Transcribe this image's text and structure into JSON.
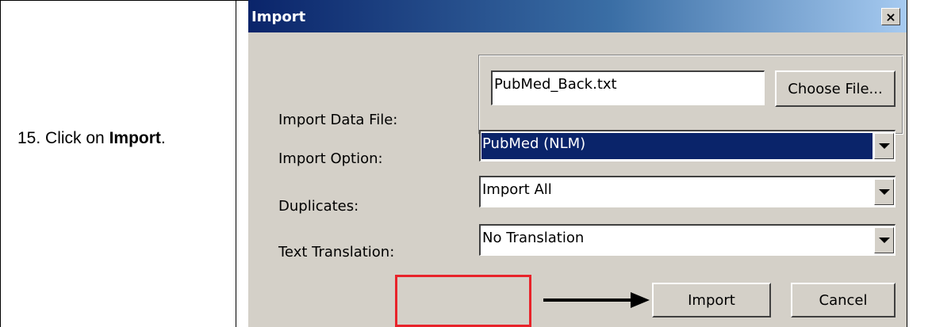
{
  "instruction": {
    "step_prefix": "15. Click on ",
    "step_target": "Import",
    "step_suffix": "."
  },
  "dialog": {
    "title": "Import",
    "close_glyph": "×",
    "import_data_file": {
      "label": "Import Data File:",
      "value": "PubMed_Back.txt",
      "choose_label": "Choose File..."
    },
    "import_option": {
      "label": "Import Option:",
      "selected": "PubMed (NLM)"
    },
    "duplicates": {
      "label": "Duplicates:",
      "selected": "Import All"
    },
    "text_translation": {
      "label": "Text Translation:",
      "selected": "No Translation"
    },
    "import_button": "Import",
    "cancel_button": "Cancel"
  },
  "colors": {
    "titlebar_start": "#0a246a",
    "titlebar_end": "#a6caf0",
    "dialog_bg": "#d4d0c8",
    "highlight": "#e8232a",
    "selection": "#0a246a"
  }
}
